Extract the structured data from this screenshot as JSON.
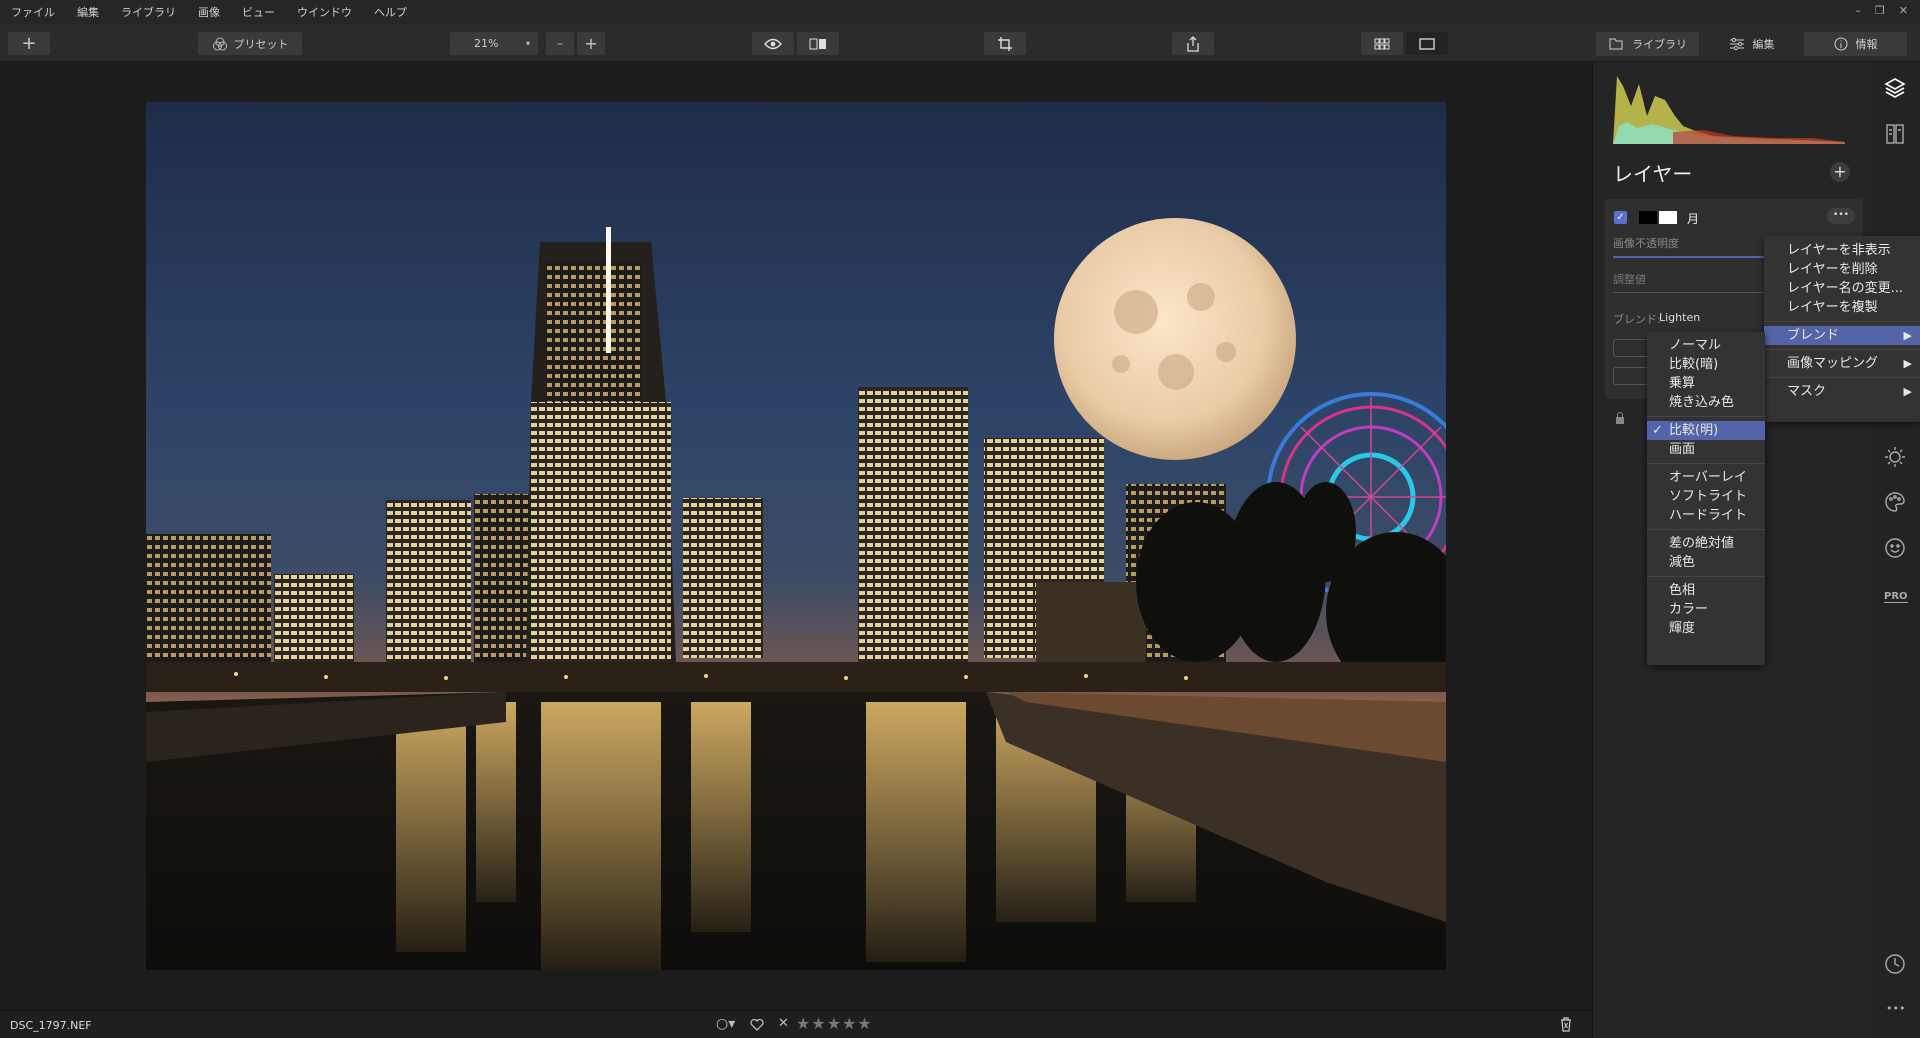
{
  "menubar": {
    "items": [
      "ファイル",
      "編集",
      "ライブラリ",
      "画像",
      "ビュー",
      "ウインドウ",
      "ヘルプ"
    ],
    "window_controls": [
      "–",
      "❐",
      "✕"
    ]
  },
  "toolbar": {
    "add_label": "+",
    "preset_label": "プリセット",
    "zoom_value": "21%",
    "zoom_minus": "–",
    "zoom_plus": "+"
  },
  "right_tabs": [
    {
      "label": "ライブラリ",
      "icon": "library-icon"
    },
    {
      "label": "編集",
      "icon": "sliders-icon"
    },
    {
      "label": "情報",
      "icon": "info-icon"
    }
  ],
  "layers": {
    "title": "レイヤー",
    "add_label": "+",
    "layer_name": "月",
    "opacity_label": "画像不透明度",
    "adjust_label": "調整値",
    "blend_label": "ブレンド:",
    "blend_value": "Lighten",
    "more_label": "•••"
  },
  "context_menu": {
    "items": [
      "レイヤーを非表示",
      "レイヤーを削除",
      "レイヤー名の変更...",
      "レイヤーを複製"
    ],
    "blend": "ブレンド",
    "image_mapping": "画像マッピング",
    "mask": "マスク"
  },
  "blend_menu": {
    "group1": [
      "ノーマル",
      "比較(暗)",
      "乗算",
      "焼き込み色"
    ],
    "checked": "比較(明)",
    "check_mark": "✓",
    "group2_rest": [
      "画面"
    ],
    "group3": [
      "オーバーレイ",
      "ソフトライト",
      "ハードライト"
    ],
    "group4": [
      "差の絶対値",
      "減色"
    ],
    "group5": [
      "色相",
      "カラー",
      "輝度"
    ]
  },
  "side_icons": [
    "layers-icon",
    "compare-icon",
    "sun-icon",
    "palette-icon",
    "face-icon",
    "pro-badge",
    "history-icon",
    "more-icon"
  ],
  "side_pro_label": "PRO",
  "side_more_label": "•••",
  "bottom": {
    "filename": "DSC_1797.NEF",
    "rating_stars": "★★★★★",
    "reject": "✕"
  },
  "colors": {
    "accent": "#5464a8",
    "checkbox": "#5b6fd0"
  }
}
